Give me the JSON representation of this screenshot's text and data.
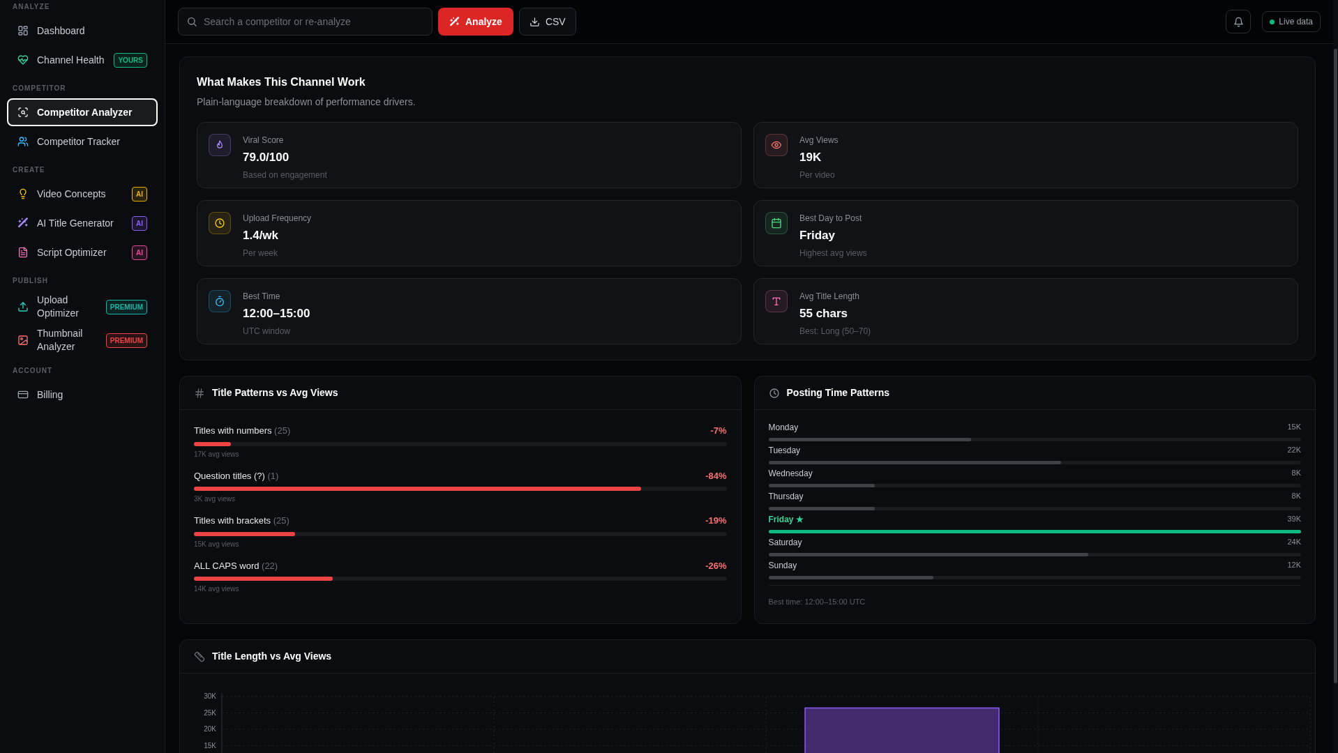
{
  "sidebar": {
    "sections": [
      {
        "heading": "ANALYZE",
        "items": [
          {
            "label": "Dashboard",
            "selected": false
          },
          {
            "label": "Channel Health",
            "selected": false,
            "badge": {
              "text": "YOURS",
              "color": "#10b981"
            }
          }
        ]
      },
      {
        "heading": "COMPETITOR",
        "items": [
          {
            "label": "Competitor Analyzer",
            "selected": true
          },
          {
            "label": "Competitor Tracker",
            "selected": false
          }
        ]
      },
      {
        "heading": "CREATE",
        "items": [
          {
            "label": "Video Concepts",
            "selected": false,
            "badge": {
              "text": "AI",
              "color": "#eab308"
            }
          },
          {
            "label": "AI Title Generator",
            "selected": false,
            "badge": {
              "text": "AI",
              "color": "#8b5cf6"
            }
          },
          {
            "label": "Script Optimizer",
            "selected": false,
            "badge": {
              "text": "AI",
              "color": "#ec4899"
            }
          }
        ]
      },
      {
        "heading": "PUBLISH",
        "items": [
          {
            "label": "Upload Optimizer",
            "selected": false,
            "badge": {
              "text": "PREMIUM",
              "color": "#14b8a6"
            }
          },
          {
            "label": "Thumbnail Analyzer",
            "selected": false,
            "badge": {
              "text": "PREMIUM",
              "color": "#ef4444"
            }
          }
        ]
      },
      {
        "heading": "ACCOUNT",
        "items": [
          {
            "label": "Billing",
            "selected": false
          }
        ]
      }
    ]
  },
  "topbar": {
    "search": {
      "placeholder": "Search a competitor or re-analyze"
    },
    "buttons": [
      "Analyze",
      "CSV"
    ],
    "status": "Live data"
  },
  "summary": {
    "title": "What Makes This Channel Work",
    "subtitle": "Plain-language breakdown of performance drivers.",
    "cards": [
      {
        "label": "Viral Score",
        "value": "79.0/100",
        "note": "Based on engagement",
        "color": "#a78bfa"
      },
      {
        "label": "Avg Views",
        "value": "19K",
        "note": "Per video",
        "color": "#f87171"
      },
      {
        "label": "Upload Frequency",
        "value": "1.4/wk",
        "note": "Per week",
        "color": "#facc15"
      },
      {
        "label": "Best Day to Post",
        "value": "Friday",
        "note": "Highest avg views",
        "color": "#4ade80"
      },
      {
        "label": "Best Time",
        "value": "12:00–15:00",
        "note": "UTC window",
        "color": "#38bdf8"
      },
      {
        "label": "Avg Title Length",
        "value": "55 chars",
        "note": "Best: Long (50–70)",
        "color": "#f472b6"
      }
    ]
  },
  "title_patterns": {
    "title": "Title Patterns vs Avg Views",
    "rows": [
      {
        "label": "Titles with numbers",
        "count": "(25)",
        "change": "-7%",
        "level": 0.07,
        "note": "17K avg views"
      },
      {
        "label": "Question titles (?)",
        "count": "(1)",
        "change": "-84%",
        "level": 0.84,
        "note": "3K avg views"
      },
      {
        "label": "Titles with brackets",
        "count": "(25)",
        "change": "-19%",
        "level": 0.19,
        "note": "15K avg views"
      },
      {
        "label": "ALL CAPS word",
        "count": "(22)",
        "change": "-26%",
        "level": 0.26,
        "note": "14K avg views"
      }
    ]
  },
  "posting_times": {
    "title": "Posting Time Patterns",
    "rows": [
      {
        "day": "Monday",
        "value": "15K",
        "level": 0.38,
        "selected": false
      },
      {
        "day": "Tuesday",
        "value": "22K",
        "level": 0.55,
        "selected": false
      },
      {
        "day": "Wednesday",
        "value": "8K",
        "level": 0.2,
        "selected": false
      },
      {
        "day": "Thursday",
        "value": "8K",
        "level": 0.2,
        "selected": false
      },
      {
        "day": "Friday ★",
        "value": "39K",
        "level": 1,
        "selected": true
      },
      {
        "day": "Saturday",
        "value": "24K",
        "level": 0.6,
        "selected": false
      },
      {
        "day": "Sunday",
        "value": "12K",
        "level": 0.31,
        "selected": false
      }
    ],
    "footer": "Best time: 12:00–15:00 UTC"
  },
  "title_length": {
    "title": "Title Length vs Avg Views",
    "chart_data": {
      "type": "bar",
      "grid": true,
      "ylim": [
        10000,
        30000
      ],
      "yticks": [
        {
          "value": 15000,
          "label": "15K"
        },
        {
          "value": 20000,
          "label": "20K"
        },
        {
          "value": 25000,
          "label": "25K"
        },
        {
          "value": 30000,
          "label": "30K"
        }
      ],
      "values": [
        null,
        null,
        26500,
        null
      ]
    }
  }
}
